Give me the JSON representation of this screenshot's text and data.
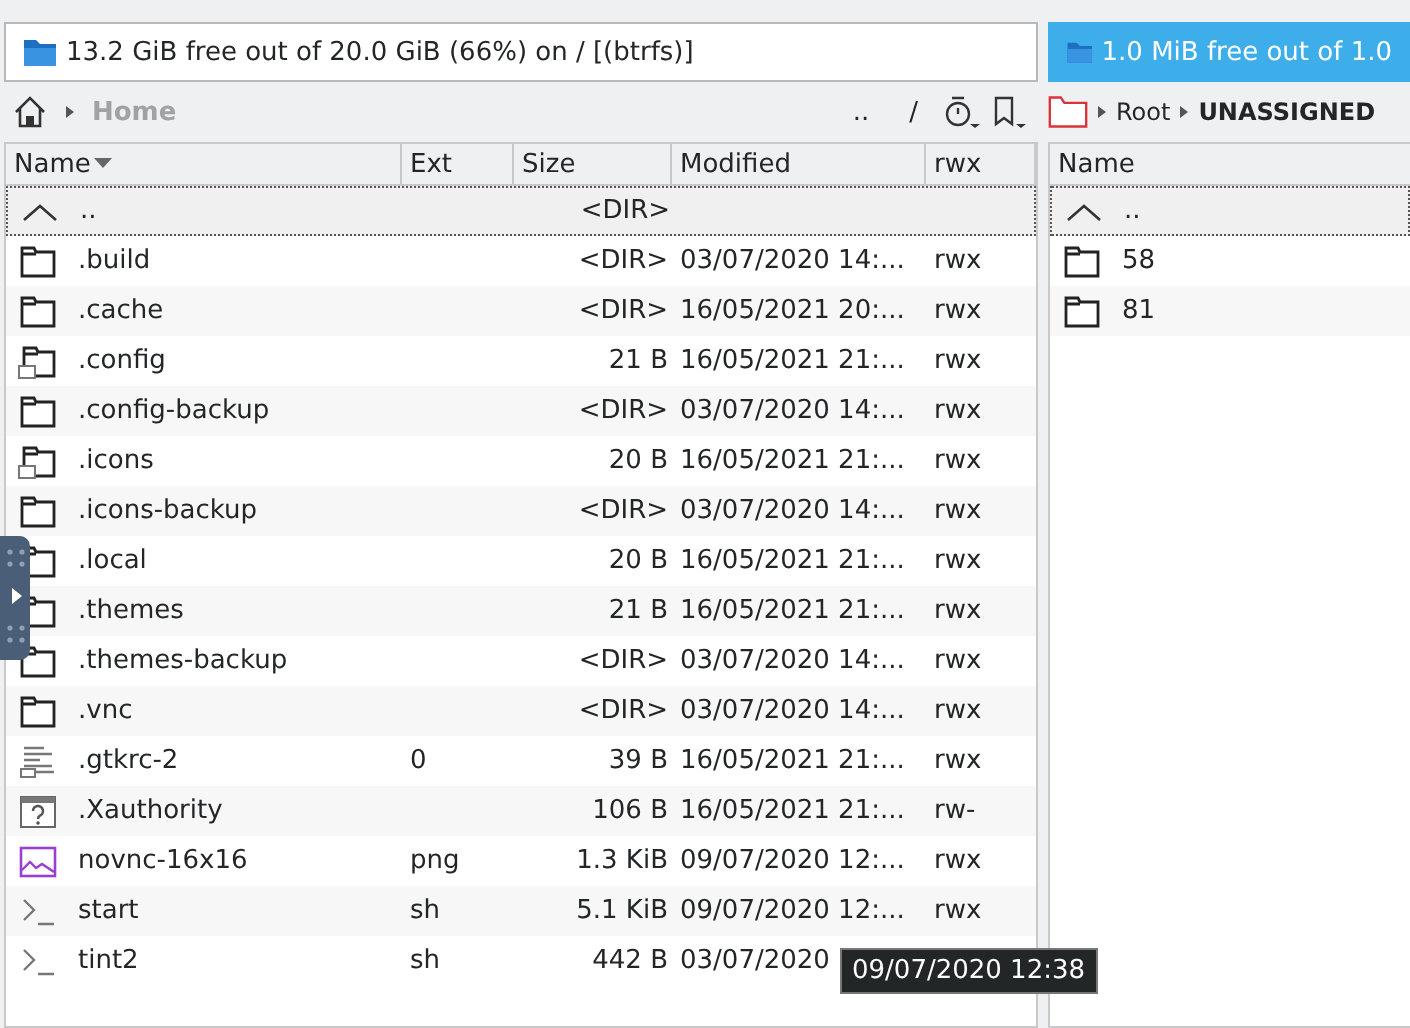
{
  "panels": [
    {
      "drive": {
        "label": "13.2 GiB free out of 20.0 GiB (66%) on / [(btrfs)]",
        "selected": false
      },
      "breadcrumb": {
        "kind": "home",
        "items": [
          "Home"
        ]
      },
      "nav": {
        "up": "..",
        "root": "/"
      },
      "columns": [
        {
          "label": "Name",
          "sorted": true
        },
        {
          "label": "Ext",
          "sorted": false
        },
        {
          "label": "Size",
          "sorted": false
        },
        {
          "label": "Modified",
          "sorted": false
        },
        {
          "label": "rwx",
          "sorted": false
        }
      ],
      "rows": [
        {
          "kind": "up",
          "name": "..",
          "size": "<DIR>",
          "focused": true
        },
        {
          "kind": "folder",
          "name": ".build",
          "size": "<DIR>",
          "modified": "03/07/2020 14:...",
          "rwx": "rwx",
          "focused": false
        },
        {
          "kind": "folder",
          "name": ".cache",
          "size": "<DIR>",
          "modified": "16/05/2021 20:...",
          "rwx": "rwx",
          "focused": false
        },
        {
          "kind": "link",
          "name": ".config",
          "size": "21 B",
          "modified": "16/05/2021 21:...",
          "rwx": "rwx",
          "focused": false
        },
        {
          "kind": "folder",
          "name": ".config-backup",
          "size": "<DIR>",
          "modified": "03/07/2020 14:...",
          "rwx": "rwx",
          "focused": false
        },
        {
          "kind": "link",
          "name": ".icons",
          "size": "20 B",
          "modified": "16/05/2021 21:...",
          "rwx": "rwx",
          "focused": false
        },
        {
          "kind": "folder",
          "name": ".icons-backup",
          "size": "<DIR>",
          "modified": "03/07/2020 14:...",
          "rwx": "rwx",
          "focused": false
        },
        {
          "kind": "folder",
          "name": ".local",
          "size": "20 B",
          "modified": "16/05/2021 21:...",
          "rwx": "rwx",
          "focused": false
        },
        {
          "kind": "folder",
          "name": ".themes",
          "size": "21 B",
          "modified": "16/05/2021 21:...",
          "rwx": "rwx",
          "focused": false
        },
        {
          "kind": "folder",
          "name": ".themes-backup",
          "size": "<DIR>",
          "modified": "03/07/2020 14:...",
          "rwx": "rwx",
          "focused": false
        },
        {
          "kind": "folder",
          "name": ".vnc",
          "size": "<DIR>",
          "modified": "03/07/2020 14:...",
          "rwx": "rwx",
          "focused": false
        },
        {
          "kind": "text",
          "name": ".gtkrc-2",
          "ext": "0",
          "size": "39 B",
          "modified": "16/05/2021 21:...",
          "rwx": "rwx",
          "focused": false
        },
        {
          "kind": "unknown",
          "name": ".Xauthority",
          "size": "106 B",
          "modified": "16/05/2021 21:...",
          "rwx": "rw-",
          "focused": false
        },
        {
          "kind": "image",
          "name": "novnc-16x16",
          "ext": "png",
          "size": "1.3 KiB",
          "modified": "09/07/2020 12:...",
          "rwx": "rwx",
          "focused": false
        },
        {
          "kind": "script",
          "name": "start",
          "ext": "sh",
          "size": "5.1 KiB",
          "modified": "09/07/2020 12:...",
          "rwx": "rwx",
          "focused": false
        },
        {
          "kind": "script",
          "name": "tint2",
          "ext": "sh",
          "size": "442 B",
          "modified": "03/07/2020",
          "focused": false
        }
      ]
    },
    {
      "drive": {
        "label": "1.0 MiB free out of 1.0",
        "selected": true
      },
      "breadcrumb": {
        "kind": "root",
        "items": [
          "Root",
          "UNASSIGNED"
        ]
      },
      "columns": [
        {
          "label": "Name",
          "sorted": false
        }
      ],
      "rows": [
        {
          "kind": "up",
          "name": "..",
          "focused": true
        },
        {
          "kind": "folder",
          "name": "58",
          "focused": false
        },
        {
          "kind": "folder",
          "name": "81",
          "focused": false
        }
      ]
    }
  ],
  "tooltip": "09/07/2020 12:38"
}
